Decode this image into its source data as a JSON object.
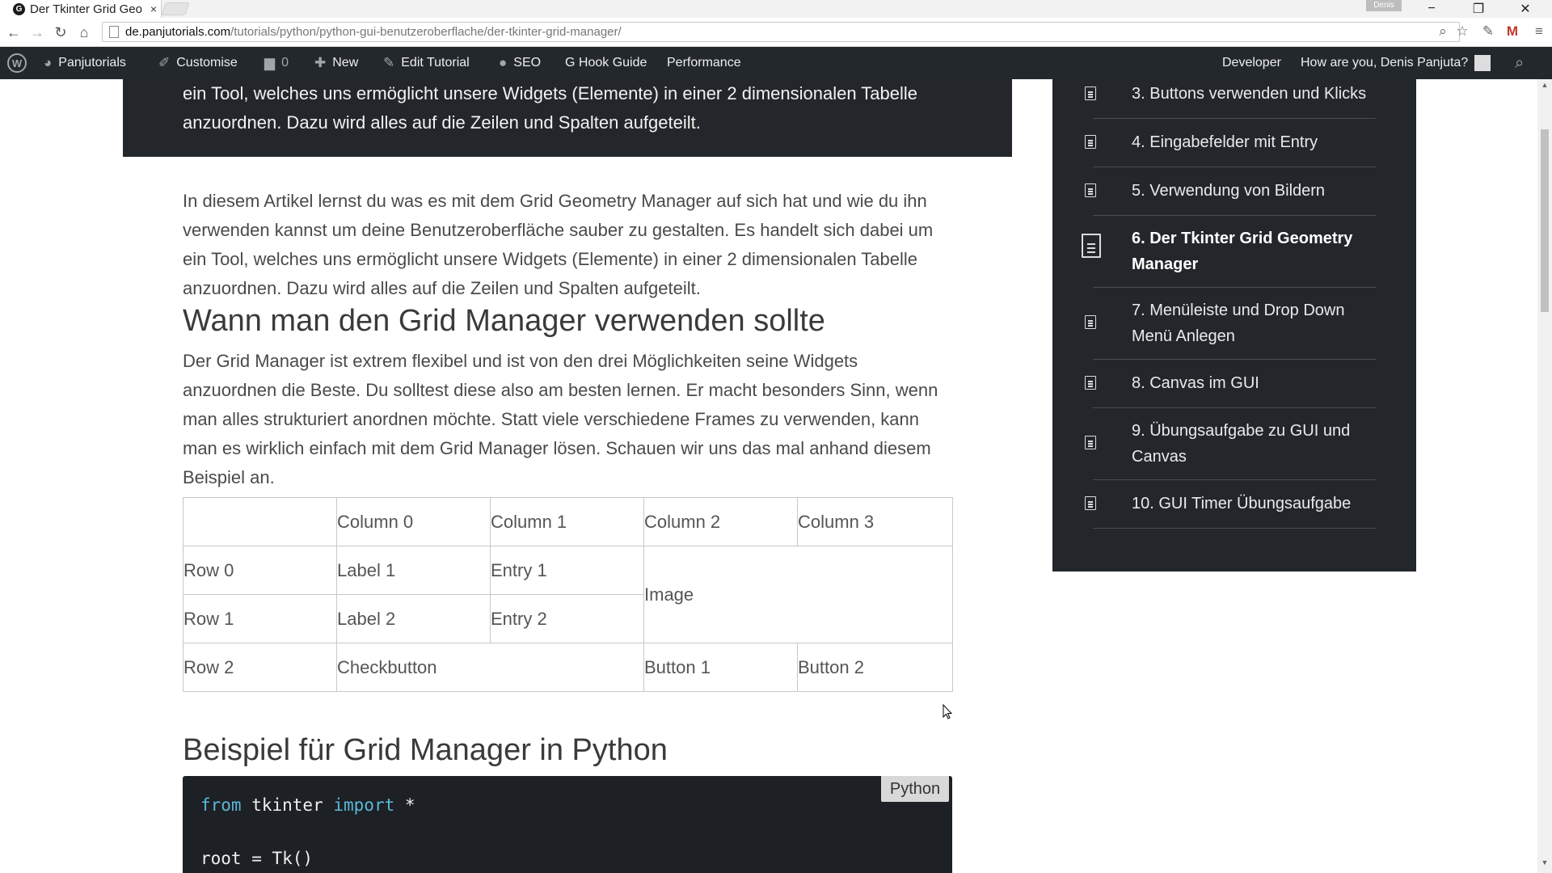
{
  "browser": {
    "tab_title": "Der Tkinter Grid Geo",
    "tab_favicon": "G",
    "tab_close": "×",
    "profile_name": "Denis",
    "url_domain": "de.panjutorials.com",
    "url_path": "/tutorials/python/python-gui-benutzeroberflache/der-tkinter-grid-manager/",
    "window_controls": [
      "−",
      "❐",
      "✕"
    ],
    "nav_icons": [
      "back-arrow-icon",
      "forward-arrow-icon",
      "reload-icon",
      "home-icon"
    ]
  },
  "adminbar": {
    "site_name": "Panjutorials",
    "customise": "Customise",
    "comments_count": "0",
    "new": "New",
    "edit_tutorial": "Edit Tutorial",
    "seo": "SEO",
    "hook_guide": "G Hook Guide",
    "performance": "Performance",
    "developer": "Developer",
    "greeting": "How are you, Denis Panjuta?"
  },
  "hero": {
    "text": "ein Tool, welches uns ermöglicht unsere Widgets (Elemente) in einer 2 dimensionalen Tabelle anzuordnen. Dazu wird alles auf die Zeilen und Spalten aufgeteilt."
  },
  "article": {
    "intro": "In diesem Artikel lernst du was es mit dem Grid Geometry Manager auf sich hat und wie du ihn verwenden kannst um deine Benutzeroberfläche sauber zu gestalten. Es handelt sich dabei um ein Tool, welches uns ermöglicht unsere Widgets (Elemente) in einer 2 dimensionalen Tabelle anzuordnen. Dazu wird alles auf die Zeilen und Spalten aufgeteilt.",
    "heading1": "Wann man den Grid Manager verwenden sollte",
    "para2": "Der Grid Manager ist extrem flexibel und ist von den drei Möglichkeiten seine Widgets anzuordnen die Beste. Du solltest diese also am besten lernen. Er macht besonders Sinn, wenn man alles strukturiert anordnen möchte. Statt viele verschiedene Frames zu verwenden, kann man es wirklich einfach mit dem Grid Manager lösen. Schauen wir uns das mal anhand diesem Beispiel an.",
    "table": {
      "headers": [
        "",
        "Column 0",
        "Column 1",
        "Column 2",
        "Column 3"
      ],
      "row0": [
        "Row 0",
        "Label 1",
        "Entry 1",
        "Image"
      ],
      "row1": [
        "Row 1",
        "Label 2",
        "Entry 2"
      ],
      "row2": [
        "Row 2",
        "Checkbutton",
        "Button 1",
        "Button 2"
      ]
    },
    "heading2": "Beispiel für Grid Manager in Python",
    "code_lang": "Python",
    "code": {
      "kw_from": "from",
      "module": " tkinter ",
      "kw_import": "import",
      "star": " *",
      "line3": "root = Tk()"
    }
  },
  "sidebar": {
    "items": [
      {
        "label": "3. Buttons verwenden und Klicks"
      },
      {
        "label": "4. Eingabefelder mit Entry"
      },
      {
        "label": "5. Verwendung von Bildern"
      },
      {
        "label": "6. Der Tkinter Grid Geometry Manager"
      },
      {
        "label": "7. Menüleiste und Drop Down Menü Anlegen"
      },
      {
        "label": "8. Canvas im GUI"
      },
      {
        "label": "9. Übungsaufgabe zu GUI und Canvas"
      },
      {
        "label": "10. GUI Timer Übungsaufgabe"
      }
    ]
  }
}
